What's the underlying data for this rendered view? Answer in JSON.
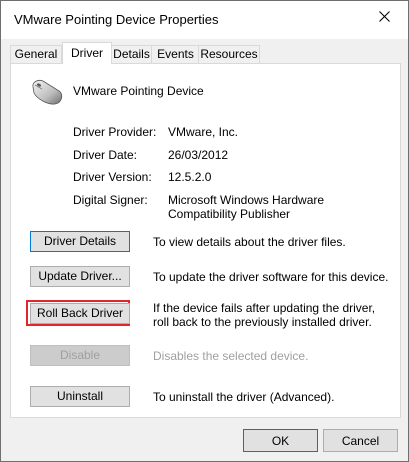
{
  "window": {
    "title": "VMware Pointing Device Properties",
    "close_icon": "close-icon"
  },
  "tabs": [
    {
      "label": "General",
      "active": false
    },
    {
      "label": "Driver",
      "active": true
    },
    {
      "label": "Details",
      "active": false
    },
    {
      "label": "Events",
      "active": false
    },
    {
      "label": "Resources",
      "active": false
    }
  ],
  "device": {
    "icon": "mouse-icon",
    "name": "VMware Pointing Device"
  },
  "info": {
    "provider_label": "Driver Provider:",
    "provider_value": "VMware, Inc.",
    "date_label": "Driver Date:",
    "date_value": "26/03/2012",
    "version_label": "Driver Version:",
    "version_value": "12.5.2.0",
    "signer_label": "Digital Signer:",
    "signer_value": "Microsoft Windows Hardware Compatibility Publisher"
  },
  "actions": {
    "details_label": "Driver Details",
    "details_desc": "To view details about the driver files.",
    "update_label": "Update Driver...",
    "update_desc": "To update the driver software for this device.",
    "rollback_label": "Roll Back Driver",
    "rollback_desc": "If the device fails after updating the driver, roll back to the previously installed driver.",
    "disable_label": "Disable",
    "disable_desc": "Disables the selected device.",
    "uninstall_label": "Uninstall",
    "uninstall_desc": "To uninstall the driver (Advanced)."
  },
  "footer": {
    "ok_label": "OK",
    "cancel_label": "Cancel"
  },
  "colors": {
    "highlight": "#e3262b",
    "focus": "#0078d7"
  }
}
